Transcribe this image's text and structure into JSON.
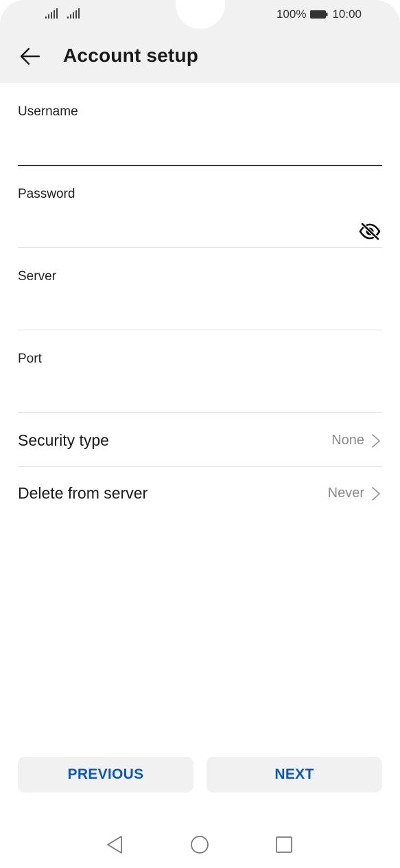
{
  "status_bar": {
    "battery": "100%",
    "time": "10:00",
    "icons": [
      "signal-icon",
      "signal-icon",
      "battery-icon"
    ]
  },
  "app_bar": {
    "title": "Account setup",
    "back_icon": "arrow-left-icon"
  },
  "form": {
    "username": {
      "label": "Username",
      "value": ""
    },
    "password": {
      "label": "Password",
      "value": "",
      "toggle_icon": "eye-off-icon"
    },
    "server": {
      "label": "Server",
      "value": ""
    },
    "port": {
      "label": "Port",
      "value": ""
    }
  },
  "settings": {
    "security_type": {
      "label": "Security type",
      "value": "None"
    },
    "delete_from_server": {
      "label": "Delete from server",
      "value": "Never"
    }
  },
  "buttons": {
    "previous": "PREVIOUS",
    "next": "NEXT"
  },
  "colors": {
    "accent": "#0a59b8",
    "header_bg": "#f1f1f1",
    "secondary_text": "#8a8a8a"
  },
  "nav_bar": {
    "icons": [
      "nav-back-icon",
      "nav-home-icon",
      "nav-recents-icon"
    ]
  }
}
